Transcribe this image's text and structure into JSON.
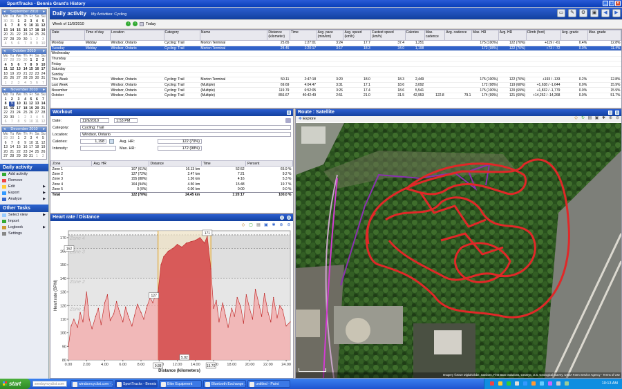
{
  "window": {
    "title": "SportTracks - Bennis Grant's History"
  },
  "calendars": [
    {
      "month": "September 2010",
      "weeks": [
        [
          "30",
          "31",
          "1",
          "2",
          "3",
          "4",
          "5"
        ],
        [
          "6",
          "7",
          "8",
          "9",
          "10",
          "11",
          "12"
        ],
        [
          "13",
          "14",
          "15",
          "16",
          "17",
          "18",
          "19"
        ],
        [
          "20",
          "21",
          "22",
          "23",
          "24",
          "25",
          "26"
        ],
        [
          "27",
          "28",
          "29",
          "30",
          "1",
          "2",
          "3"
        ],
        [
          "4",
          "5",
          "6",
          "7",
          "8",
          "9",
          "10"
        ]
      ]
    },
    {
      "month": "October 2010",
      "weeks": [
        [
          "27",
          "28",
          "29",
          "30",
          "1",
          "2",
          "3"
        ],
        [
          "4",
          "5",
          "6",
          "7",
          "8",
          "9",
          "10"
        ],
        [
          "11",
          "12",
          "13",
          "14",
          "15",
          "16",
          "17"
        ],
        [
          "18",
          "19",
          "20",
          "21",
          "22",
          "23",
          "24"
        ],
        [
          "25",
          "26",
          "27",
          "28",
          "29",
          "30",
          "31"
        ],
        [
          "1",
          "2",
          "3",
          "4",
          "5",
          "6",
          "7"
        ]
      ]
    },
    {
      "month": "November 2010",
      "weeks": [
        [
          "1",
          "2",
          "3",
          "4",
          "5",
          "6",
          "7"
        ],
        [
          "8",
          "9",
          "10",
          "11",
          "12",
          "13",
          "14"
        ],
        [
          "15",
          "16",
          "17",
          "18",
          "19",
          "20",
          "21"
        ],
        [
          "22",
          "23",
          "24",
          "25",
          "26",
          "27",
          "28"
        ],
        [
          "29",
          "30",
          "1",
          "2",
          "3",
          "4",
          "5"
        ],
        [
          "6",
          "7",
          "8",
          "9",
          "10",
          "11",
          "12"
        ]
      ]
    },
    {
      "month": "December 2010",
      "weeks": [
        [
          "29",
          "30",
          "1",
          "2",
          "3",
          "4",
          "5"
        ],
        [
          "6",
          "7",
          "8",
          "9",
          "10",
          "11",
          "12"
        ],
        [
          "13",
          "14",
          "15",
          "16",
          "17",
          "18",
          "19"
        ],
        [
          "20",
          "21",
          "22",
          "23",
          "24",
          "25",
          "26"
        ],
        [
          "27",
          "28",
          "29",
          "30",
          "31",
          "1",
          "2"
        ]
      ]
    }
  ],
  "daynames": [
    "Mo",
    "Tu",
    "We",
    "Th",
    "Fr",
    "Sa",
    "Su"
  ],
  "left_panel": {
    "daily_title": "Daily activity",
    "daily_items": [
      "Add activity",
      "Remove",
      "Edit",
      "Export",
      "Analyze"
    ],
    "other_title": "Other Tasks",
    "other_items": [
      "Select view",
      "Import",
      "Logbook",
      "Settings"
    ]
  },
  "activity": {
    "title": "Daily activity",
    "breadcrumb": "My Activities: Cycling",
    "week_label": "Week of 11/8/2010",
    "today": "Today",
    "columns": [
      "Date",
      "Time of day",
      "Location",
      "Category",
      "Name",
      "Distance (kilometer)",
      "Time",
      "Avg. pace (min/km)",
      "Avg. speed (km/h)",
      "Fastest speed (km/h)",
      "Calories",
      "Max. cadence",
      "Avg. cadence",
      "Max. HR",
      "Avg. HR",
      "Climb (foot)",
      "Avg. grade",
      "Max. grade"
    ],
    "rows": [
      [
        "Monday",
        "Midday",
        "Windsor, Ontario",
        "Cycling: Trail",
        "Morton Terminal",
        "25.65",
        "1:27:01",
        "3:24",
        "17.7",
        "37.4",
        "1,251",
        "",
        "",
        "175 (100%)",
        "122 (70%)",
        "+119 / -61",
        "0.4%",
        "12.8%"
      ],
      [
        "Tuesday",
        "Midday",
        "Windsor, Ontario",
        "Cycling: Trail",
        "Morton Terminal",
        "24.45",
        "1:20:17",
        "3:17",
        "18.3",
        "34.0",
        "1,198",
        "",
        "",
        "172 (98%)",
        "122 (70%)",
        "+73 / -72",
        "0.0%",
        "11.4%"
      ],
      [
        "Wednesday",
        "",
        "",
        "",
        "",
        "",
        "",
        "",
        "",
        "",
        "",
        "",
        "",
        "",
        "",
        "",
        "",
        ""
      ],
      [
        "Thursday",
        "",
        "",
        "",
        "",
        "",
        "",
        "",
        "",
        "",
        "",
        "",
        "",
        "",
        "",
        "",
        "",
        ""
      ],
      [
        "Friday",
        "",
        "",
        "",
        "",
        "",
        "",
        "",
        "",
        "",
        "",
        "",
        "",
        "",
        "",
        "",
        "",
        ""
      ],
      [
        "Saturday",
        "",
        "",
        "",
        "",
        "",
        "",
        "",
        "",
        "",
        "",
        "",
        "",
        "",
        "",
        "",
        "",
        ""
      ],
      [
        "Sunday",
        "",
        "",
        "",
        "",
        "",
        "",
        "",
        "",
        "",
        "",
        "",
        "",
        "",
        "",
        "",
        "",
        ""
      ],
      [
        "This Week",
        "",
        "Windsor, Ontario",
        "Cycling: Trail",
        "Morton Terminal",
        "50.11",
        "2:47:18",
        "3:20",
        "18.0",
        "18.3",
        "2,449",
        "",
        "",
        "175 (100%)",
        "122 (70%)",
        "+193 / -133",
        "0.2%",
        "12.8%"
      ],
      [
        "Last Week",
        "",
        "Windsor, Ontario",
        "Cycling: Trail",
        "(Multiple)",
        "69.69",
        "4:04:47",
        "3:31",
        "17.1",
        "18.6",
        "3,092",
        "",
        "",
        "172 (98%)",
        "119 (68%)",
        "+1,638 / -1,644",
        "0.0%",
        "15.9%"
      ],
      [
        "November",
        "",
        "Windsor, Ontario",
        "Cycling: Trail",
        "(Multiple)",
        "119.79",
        "6:52:05",
        "3:26",
        "17.4",
        "18.6",
        "5,541",
        "",
        "",
        "175 (100%)",
        "120 (69%)",
        "+1,832 / -1,779",
        "0.0%",
        "15.9%"
      ],
      [
        "October",
        "",
        "Windsor, Ontario",
        "Cycling: Trail",
        "(Multiple)",
        "856.67",
        "40:42:49",
        "2:51",
        "21.0",
        "31.5",
        "42,953",
        "122.8",
        "79.1",
        "174 (99%)",
        "121 (69%)",
        "+14,252 / -14,268",
        "0.0%",
        "51.7%"
      ]
    ]
  },
  "workout": {
    "title": "Workout",
    "date_label": "Date:",
    "date": "11/9/2010",
    "time": "1:53 PM",
    "category_label": "Category:",
    "category": "Cycling: Trail",
    "location_label": "Location:",
    "location": "Windsor, Ontario",
    "calories_label": "Calories:",
    "calories": "1,198",
    "intensity_label": "Intensity:",
    "avghr_label": "Avg. HR:",
    "avghr": "122 (70%)",
    "maxhr_label": "Max. HR:",
    "maxhr": "172 (98%)",
    "zone_cols": [
      "Zone",
      "Avg. HR",
      "Distance",
      "Time",
      "Percent"
    ],
    "zones": [
      [
        "Zone 1",
        "107 (61%)",
        "16.13 km",
        "52:52",
        "65.9 %"
      ],
      [
        "Zone 2",
        "127 (72%)",
        "2.47 km",
        "7:21",
        "9.2 %"
      ],
      [
        "Zone 3",
        "155 (88%)",
        "1.36 km",
        "4:16",
        "5.3 %"
      ],
      [
        "Zone 4",
        "164 (94%)",
        "4.50 km",
        "15:48",
        "19.7 %"
      ],
      [
        "Zone 5",
        "0 (0%)",
        "0.00 km",
        "0:00",
        "0.0 %"
      ],
      [
        "Total",
        "122 (70%)",
        "24.45 km",
        "1:20:17",
        "100.0 %"
      ]
    ]
  },
  "chart_data": {
    "type": "area",
    "title": "Heart rate / Distance",
    "xlabel": "Distance (kilometers)",
    "ylabel": "Heart rate (BPM)",
    "xlim": [
      0,
      24.45
    ],
    "ylim": [
      80,
      175
    ],
    "xticks": [
      "0.00",
      "2.00",
      "4.00",
      "6.00",
      "8.00",
      "10.00",
      "12.00",
      "14.00",
      "16.00",
      "18.00",
      "20.00",
      "22.00",
      "24.00"
    ],
    "yticks": [
      "80",
      "90",
      "100",
      "110",
      "120",
      "130",
      "140",
      "150",
      "160",
      "170"
    ],
    "zones": [
      {
        "name": "Zone 1",
        "y": 120
      },
      {
        "name": "Zone 2",
        "y": 140
      },
      {
        "name": "Zone 3",
        "y": 162
      },
      {
        "name": "Zone 4",
        "y": 172
      }
    ],
    "selection": {
      "start": 9.88,
      "end": 15.7,
      "length": "5.82",
      "start_label": "9.88",
      "end_label": "15.70"
    },
    "markers": {
      "max": "171",
      "zone3": "162",
      "sel_left": "127"
    },
    "x": [
      0,
      0.3,
      0.6,
      1.0,
      1.3,
      1.6,
      2.0,
      2.3,
      2.6,
      3.0,
      3.3,
      3.6,
      4.0,
      4.3,
      4.6,
      5.0,
      5.3,
      5.6,
      6.0,
      6.3,
      6.6,
      7.0,
      7.3,
      7.6,
      8.0,
      8.3,
      8.6,
      9.0,
      9.3,
      9.6,
      9.88,
      10.2,
      10.5,
      11.0,
      11.5,
      12.0,
      12.5,
      13.0,
      13.5,
      14.0,
      14.5,
      15.0,
      15.3,
      15.7,
      16.0,
      16.3,
      16.6,
      17.0,
      17.3,
      17.6,
      18.0,
      18.3,
      18.6,
      19.0,
      19.3,
      19.6,
      20.0,
      20.3,
      20.6,
      21.0,
      21.3,
      21.6,
      22.0,
      22.3,
      22.6,
      23.0,
      23.3,
      23.6,
      24.0,
      24.45
    ],
    "values": [
      90,
      105,
      110,
      104,
      115,
      108,
      130,
      110,
      103,
      112,
      118,
      106,
      122,
      128,
      109,
      114,
      123,
      116,
      108,
      119,
      112,
      105,
      113,
      121,
      115,
      110,
      118,
      126,
      122,
      128,
      130,
      150,
      156,
      160,
      162,
      165,
      163,
      166,
      167,
      168,
      170,
      166,
      171,
      147,
      118,
      124,
      108,
      122,
      113,
      104,
      118,
      112,
      126,
      119,
      107,
      128,
      117,
      110,
      132,
      121,
      112,
      129,
      115,
      108,
      126,
      111,
      120,
      117,
      105,
      108
    ]
  },
  "route": {
    "title": "Route : Satellite",
    "explore": "Explore",
    "credit": "Imagery ©2010 DigitalGlobe, Sanborn, First Base Solutions, GeoEye, U.S. Geological Survey, USDA Farm Service Agency - Terms of Use"
  },
  "taskbar": {
    "start": "start",
    "search": "sendsyncyclist.com",
    "tasks": [
      "windsorcyclist.com - ...",
      "SportTracks - Bennis ...",
      "Bike Equipment",
      "Bluetooth Exchange ...",
      "untitled - Paint"
    ],
    "clock": "10:13 AM"
  }
}
